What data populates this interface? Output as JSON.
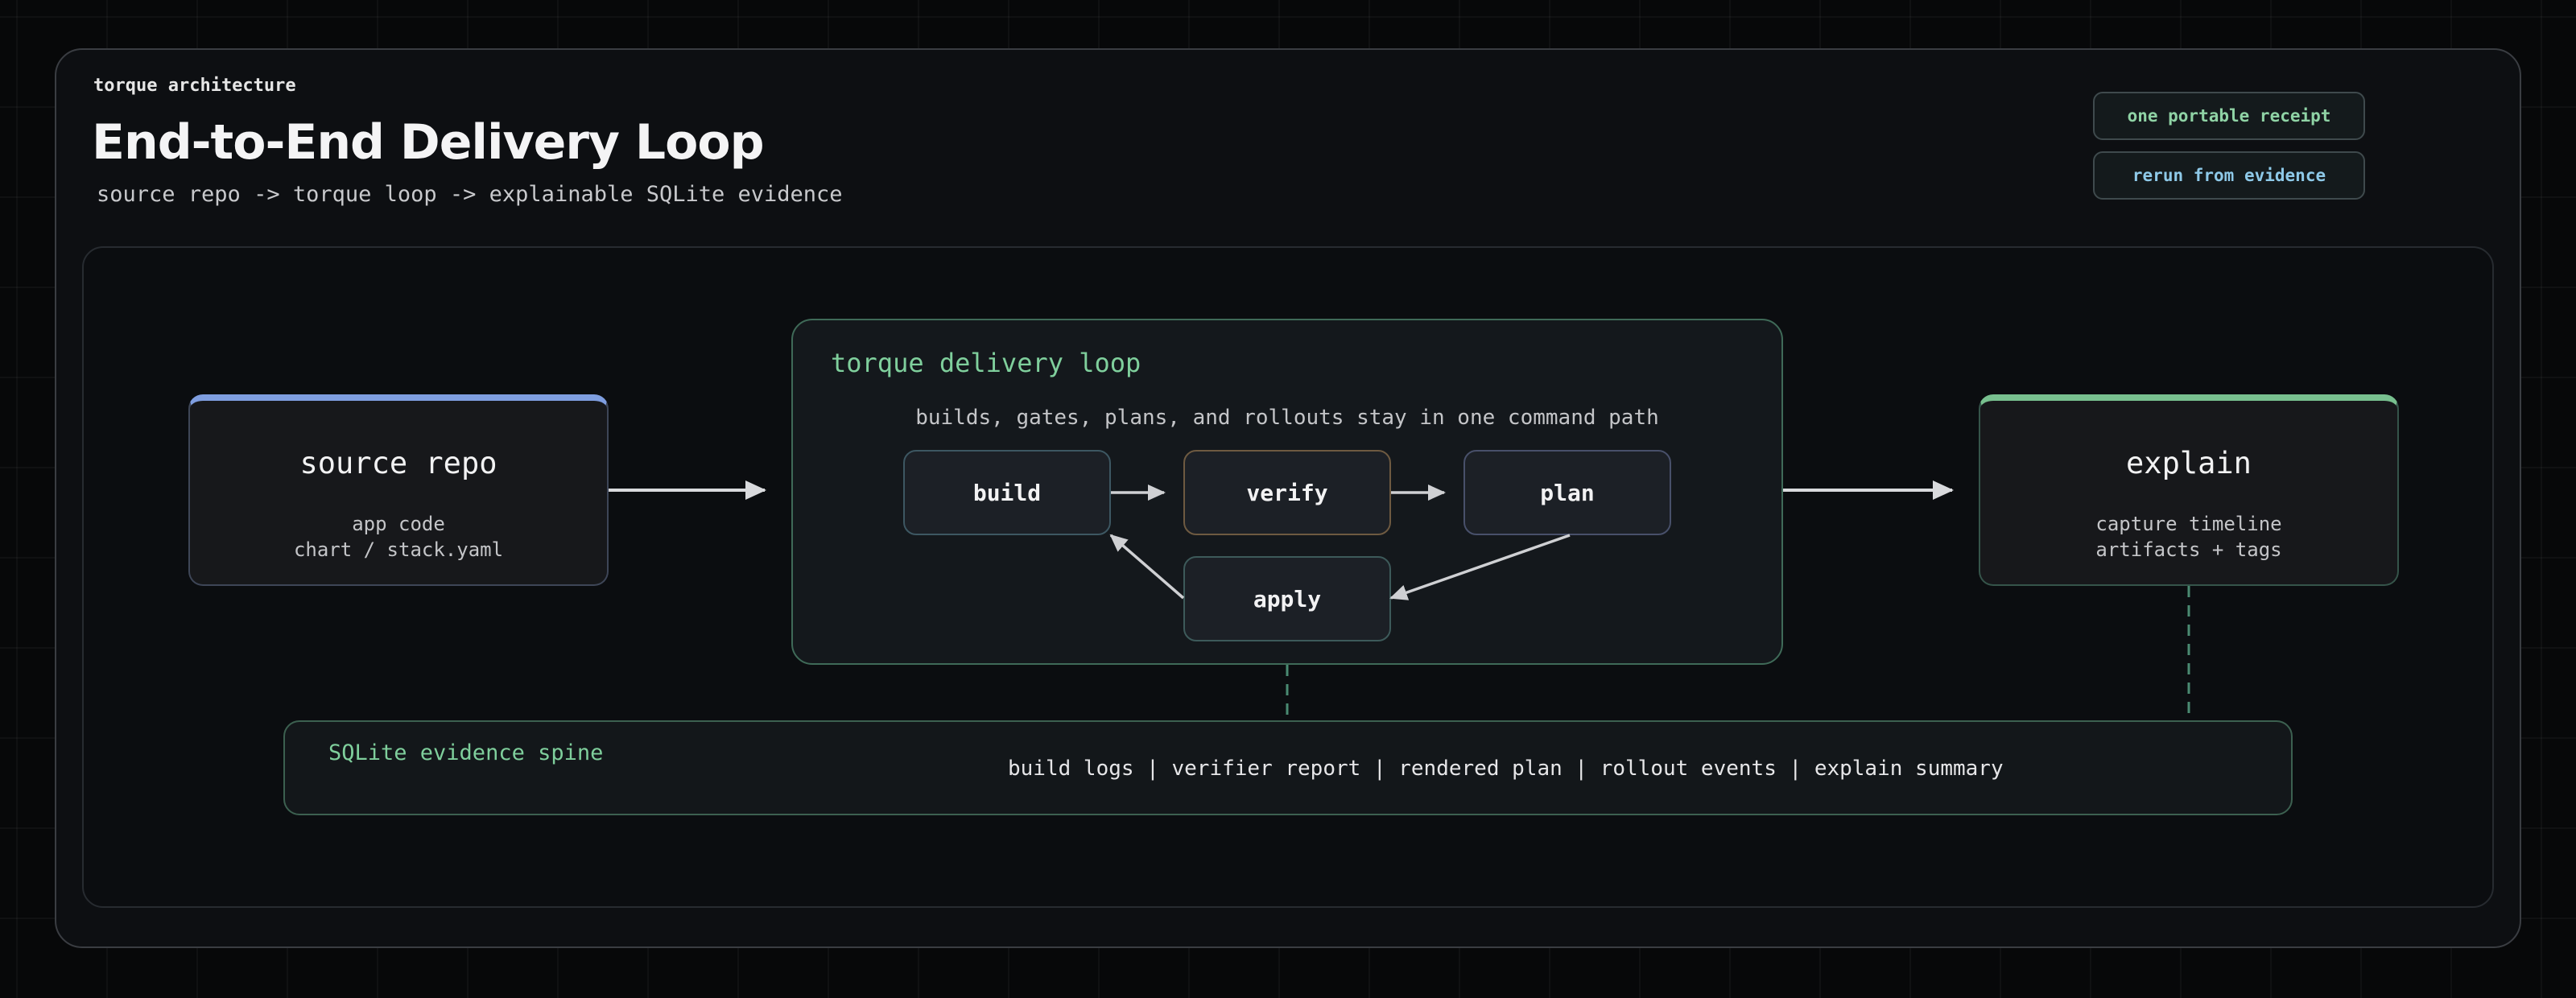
{
  "header": {
    "eyebrow": "torque architecture",
    "title": "End-to-End Delivery Loop",
    "subtitle": "source repo -> torque loop -> explainable SQLite evidence"
  },
  "badges": [
    {
      "label": "one portable receipt"
    },
    {
      "label": "rerun from evidence"
    }
  ],
  "source": {
    "title": "source repo",
    "lines": [
      "app code",
      "chart / stack.yaml"
    ]
  },
  "loop": {
    "title": "torque delivery loop",
    "caption": "builds, gates, plans, and rollouts stay in one command path",
    "steps": {
      "build": "build",
      "verify": "verify",
      "plan": "plan",
      "apply": "apply"
    }
  },
  "explain": {
    "title": "explain",
    "lines": [
      "capture timeline",
      "artifacts + tags"
    ]
  },
  "spine": {
    "title": "SQLite evidence spine",
    "items": "build logs | verifier report | rendered plan | rollout events | explain summary"
  },
  "colors": {
    "source_accent": "#7f9ee0",
    "explain_accent": "#78c08f",
    "loop_accent": "#7fcf9c",
    "arrow": "#d9dadd"
  }
}
